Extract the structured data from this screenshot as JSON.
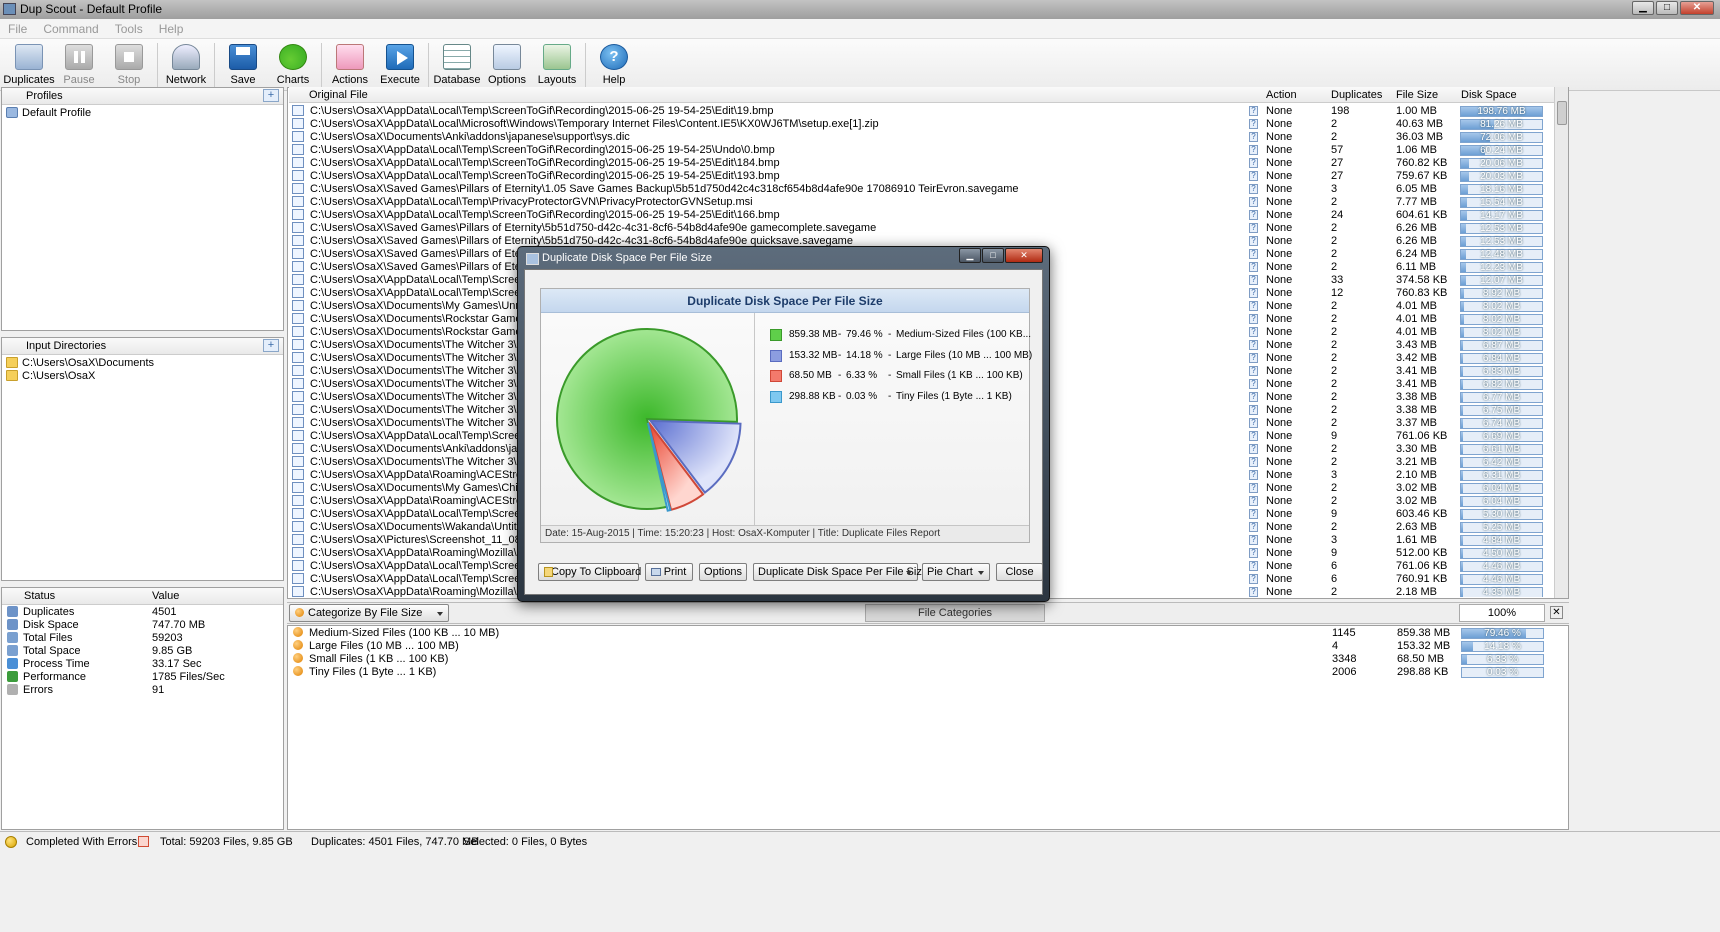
{
  "window": {
    "title": "Dup Scout - Default Profile"
  },
  "menu": [
    "File",
    "Command",
    "Tools",
    "Help"
  ],
  "toolbar": [
    {
      "label": "Duplicates",
      "icon": "duplicates-icon",
      "cls": "dup"
    },
    {
      "label": "Pause",
      "icon": "pause-icon",
      "cls": "pause",
      "disabled": true
    },
    {
      "label": "Stop",
      "icon": "stop-icon",
      "cls": "stop",
      "disabled": true
    },
    {
      "sep": true
    },
    {
      "label": "Network",
      "icon": "network-icon",
      "cls": "net"
    },
    {
      "sep": true
    },
    {
      "label": "Save",
      "icon": "save-icon",
      "cls": "save"
    },
    {
      "label": "Charts",
      "icon": "charts-icon",
      "cls": "charts"
    },
    {
      "sep": true
    },
    {
      "label": "Actions",
      "icon": "actions-icon",
      "cls": "actions"
    },
    {
      "label": "Execute",
      "icon": "execute-icon",
      "cls": "exec"
    },
    {
      "sep": true
    },
    {
      "label": "Database",
      "icon": "database-icon",
      "cls": "db"
    },
    {
      "label": "Options",
      "icon": "options-icon",
      "cls": "opt"
    },
    {
      "label": "Layouts",
      "icon": "layouts-icon",
      "cls": "lay"
    },
    {
      "sep": true
    },
    {
      "label": "Help",
      "icon": "help-icon",
      "cls": "help"
    }
  ],
  "profiles": {
    "header": "Profiles",
    "items": [
      "Default Profile"
    ]
  },
  "input_dirs": {
    "header": "Input Directories",
    "items": [
      "C:\\Users\\OsaX\\Documents",
      "C:\\Users\\OsaX"
    ]
  },
  "status_panel": {
    "col_status": "Status",
    "col_value": "Value",
    "rows": [
      {
        "label": "Duplicates",
        "value": "4501",
        "color": "#6d93c8"
      },
      {
        "label": "Disk Space",
        "value": "747.70 MB",
        "color": "#6d93c8"
      },
      {
        "label": "Total Files",
        "value": "59203",
        "color": "#7aa0d0"
      },
      {
        "label": "Total Space",
        "value": "9.85 GB",
        "color": "#7aa0d0"
      },
      {
        "label": "Process Time",
        "value": "33.17 Sec",
        "color": "#4a8fd6"
      },
      {
        "label": "Performance",
        "value": "1785 Files/Sec",
        "color": "#3c9c3c"
      },
      {
        "label": "Errors",
        "value": "91",
        "color": "#b0b0b0"
      }
    ]
  },
  "file_list": {
    "headers": {
      "file": "Original File",
      "action": "Action",
      "dups": "Duplicates",
      "size": "File Size",
      "space": "Disk Space"
    },
    "rows": [
      {
        "path": "C:\\Users\\OsaX\\AppData\\Local\\Temp\\ScreenToGif\\Recording\\2015-06-25 19-54-25\\Edit\\19.bmp",
        "action": "None",
        "dups": "198",
        "size": "1.00 MB",
        "space": "198.76 MB",
        "pct": 100
      },
      {
        "path": "C:\\Users\\OsaX\\AppData\\Local\\Microsoft\\Windows\\Temporary Internet Files\\Content.IE5\\KX0WJ6TM\\setup.exe[1].zip",
        "action": "None",
        "dups": "2",
        "size": "40.63 MB",
        "space": "81.26 MB",
        "pct": 41
      },
      {
        "path": "C:\\Users\\OsaX\\Documents\\Anki\\addons\\japanese\\support\\sys.dic",
        "action": "None",
        "dups": "2",
        "size": "36.03 MB",
        "space": "72.06 MB",
        "pct": 36
      },
      {
        "path": "C:\\Users\\OsaX\\AppData\\Local\\Temp\\ScreenToGif\\Recording\\2015-06-25 19-54-25\\Undo\\0.bmp",
        "action": "None",
        "dups": "57",
        "size": "1.06 MB",
        "space": "60.24 MB",
        "pct": 30
      },
      {
        "path": "C:\\Users\\OsaX\\AppData\\Local\\Temp\\ScreenToGif\\Recording\\2015-06-25 19-54-25\\Edit\\184.bmp",
        "action": "None",
        "dups": "27",
        "size": "760.82 KB",
        "space": "20.06 MB",
        "pct": 10
      },
      {
        "path": "C:\\Users\\OsaX\\AppData\\Local\\Temp\\ScreenToGif\\Recording\\2015-06-25 19-54-25\\Edit\\193.bmp",
        "action": "None",
        "dups": "27",
        "size": "759.67 KB",
        "space": "20.03 MB",
        "pct": 10
      },
      {
        "path": "C:\\Users\\OsaX\\Saved Games\\Pillars of Eternity\\1.05 Save Games Backup\\5b51d750d42c4c318cf654b8d4afe90e 17086910 TeirEvron.savegame",
        "action": "None",
        "dups": "3",
        "size": "6.05 MB",
        "space": "18.16 MB",
        "pct": 9
      },
      {
        "path": "C:\\Users\\OsaX\\AppData\\Local\\Temp\\PrivacyProtectorGVN\\PrivacyProtectorGVNSetup.msi",
        "action": "None",
        "dups": "2",
        "size": "7.77 MB",
        "space": "15.54 MB",
        "pct": 8
      },
      {
        "path": "C:\\Users\\OsaX\\AppData\\Local\\Temp\\ScreenToGif\\Recording\\2015-06-25 19-54-25\\Edit\\166.bmp",
        "action": "None",
        "dups": "24",
        "size": "604.61 KB",
        "space": "14.17 MB",
        "pct": 7
      },
      {
        "path": "C:\\Users\\OsaX\\Saved Games\\Pillars of Eternity\\5b51d750-d42c-4c31-8cf6-54b8d4afe90e gamecomplete.savegame",
        "action": "None",
        "dups": "2",
        "size": "6.26 MB",
        "space": "12.53 MB",
        "pct": 6
      },
      {
        "path": "C:\\Users\\OsaX\\Saved Games\\Pillars of Eternity\\5b51d750-d42c-4c31-8cf6-54b8d4afe90e quicksave.savegame",
        "action": "None",
        "dups": "2",
        "size": "6.26 MB",
        "space": "12.53 MB",
        "pct": 6
      },
      {
        "path": "C:\\Users\\OsaX\\Saved Games\\Pillars of Eternity\\5",
        "action": "None",
        "dups": "2",
        "size": "6.24 MB",
        "space": "12.48 MB",
        "pct": 6
      },
      {
        "path": "C:\\Users\\OsaX\\Saved Games\\Pillars of Eternity\\5",
        "action": "None",
        "dups": "2",
        "size": "6.11 MB",
        "space": "12.23 MB",
        "pct": 6
      },
      {
        "path": "C:\\Users\\OsaX\\AppData\\Local\\Temp\\ScreenToG",
        "action": "None",
        "dups": "33",
        "size": "374.58 KB",
        "space": "12.07 MB",
        "pct": 6
      },
      {
        "path": "C:\\Users\\OsaX\\AppData\\Local\\Temp\\ScreenToG",
        "action": "None",
        "dups": "12",
        "size": "760.83 KB",
        "space": "8.92 MB",
        "pct": 4
      },
      {
        "path": "C:\\Users\\OsaX\\Documents\\My Games\\UnrealEn",
        "action": "None",
        "dups": "2",
        "size": "4.01 MB",
        "space": "8.02 MB",
        "pct": 4
      },
      {
        "path": "C:\\Users\\OsaX\\Documents\\Rockstar Games\\Soc",
        "action": "None",
        "dups": "2",
        "size": "4.01 MB",
        "space": "8.02 MB",
        "pct": 4
      },
      {
        "path": "C:\\Users\\OsaX\\Documents\\Rockstar Games\\Soc",
        "action": "None",
        "dups": "2",
        "size": "4.01 MB",
        "space": "8.02 MB",
        "pct": 4
      },
      {
        "path": "C:\\Users\\OsaX\\Documents\\The Witcher 3\\game",
        "action": "None",
        "dups": "2",
        "size": "3.43 MB",
        "space": "6.87 MB",
        "pct": 3
      },
      {
        "path": "C:\\Users\\OsaX\\Documents\\The Witcher 3\\game",
        "action": "None",
        "dups": "2",
        "size": "3.42 MB",
        "space": "6.84 MB",
        "pct": 3
      },
      {
        "path": "C:\\Users\\OsaX\\Documents\\The Witcher 3\\game",
        "action": "None",
        "dups": "2",
        "size": "3.41 MB",
        "space": "6.83 MB",
        "pct": 3
      },
      {
        "path": "C:\\Users\\OsaX\\Documents\\The Witcher 3\\game",
        "action": "None",
        "dups": "2",
        "size": "3.41 MB",
        "space": "6.82 MB",
        "pct": 3
      },
      {
        "path": "C:\\Users\\OsaX\\Documents\\The Witcher 3\\game",
        "action": "None",
        "dups": "2",
        "size": "3.38 MB",
        "space": "6.77 MB",
        "pct": 3
      },
      {
        "path": "C:\\Users\\OsaX\\Documents\\The Witcher 3\\game",
        "action": "None",
        "dups": "2",
        "size": "3.38 MB",
        "space": "6.75 MB",
        "pct": 3
      },
      {
        "path": "C:\\Users\\OsaX\\Documents\\The Witcher 3\\game",
        "action": "None",
        "dups": "2",
        "size": "3.37 MB",
        "space": "6.74 MB",
        "pct": 3
      },
      {
        "path": "C:\\Users\\OsaX\\AppData\\Local\\Temp\\ScreenToG",
        "action": "None",
        "dups": "9",
        "size": "761.06 KB",
        "space": "6.69 MB",
        "pct": 3
      },
      {
        "path": "C:\\Users\\OsaX\\Documents\\Anki\\addons\\japane",
        "action": "None",
        "dups": "2",
        "size": "3.30 MB",
        "space": "6.61 MB",
        "pct": 3
      },
      {
        "path": "C:\\Users\\OsaX\\Documents\\The Witcher 3\\game",
        "action": "None",
        "dups": "2",
        "size": "3.21 MB",
        "space": "6.42 MB",
        "pct": 3
      },
      {
        "path": "C:\\Users\\OsaX\\AppData\\Roaming\\ACEStream\\u",
        "action": "None",
        "dups": "3",
        "size": "2.10 MB",
        "space": "6.31 MB",
        "pct": 3
      },
      {
        "path": "C:\\Users\\OsaX\\Documents\\My Games\\Chivalry",
        "action": "None",
        "dups": "2",
        "size": "3.02 MB",
        "space": "6.04 MB",
        "pct": 3
      },
      {
        "path": "C:\\Users\\OsaX\\AppData\\Roaming\\ACEStream\\u",
        "action": "None",
        "dups": "2",
        "size": "3.02 MB",
        "space": "6.04 MB",
        "pct": 3
      },
      {
        "path": "C:\\Users\\OsaX\\AppData\\Local\\Temp\\ScreenToG",
        "action": "None",
        "dups": "9",
        "size": "603.46 KB",
        "space": "5.30 MB",
        "pct": 3
      },
      {
        "path": "C:\\Users\\OsaX\\Documents\\Wakanda\\Untitled\\U",
        "action": "None",
        "dups": "2",
        "size": "2.63 MB",
        "space": "5.25 MB",
        "pct": 3
      },
      {
        "path": "C:\\Users\\OsaX\\Pictures\\Screenshot_11_08_2015_",
        "action": "None",
        "dups": "3",
        "size": "1.61 MB",
        "space": "4.84 MB",
        "pct": 2
      },
      {
        "path": "C:\\Users\\OsaX\\AppData\\Roaming\\Mozilla\\Firefo",
        "action": "None",
        "dups": "9",
        "size": "512.00 KB",
        "space": "4.50 MB",
        "pct": 2
      },
      {
        "path": "C:\\Users\\OsaX\\AppData\\Local\\Temp\\ScreenToG",
        "action": "None",
        "dups": "6",
        "size": "761.06 KB",
        "space": "4.46 MB",
        "pct": 2
      },
      {
        "path": "C:\\Users\\OsaX\\AppData\\Local\\Temp\\ScreenToG",
        "action": "None",
        "dups": "6",
        "size": "760.91 KB",
        "space": "4.46 MB",
        "pct": 2
      },
      {
        "path": "C:\\Users\\OsaX\\AppData\\Roaming\\Mozilla\\Firefo",
        "action": "None",
        "dups": "2",
        "size": "2.18 MB",
        "space": "4.35 MB",
        "pct": 2
      }
    ]
  },
  "midbar": {
    "categorize": "Categorize By File Size",
    "tab": "File Categories",
    "percent": "100%"
  },
  "categories": [
    {
      "label": "Medium-Sized Files (100 KB ... 10 MB)",
      "count": "1145",
      "size": "859.38 MB",
      "pct_label": "79.46 %",
      "pct": 79.46
    },
    {
      "label": "Large Files (10 MB ... 100 MB)",
      "count": "4",
      "size": "153.32 MB",
      "pct_label": "14.18 %",
      "pct": 14.18
    },
    {
      "label": "Small Files (1 KB ... 100 KB)",
      "count": "3348",
      "size": "68.50 MB",
      "pct_label": "6.33 %",
      "pct": 6.33
    },
    {
      "label": "Tiny Files (1 Byte ... 1 KB)",
      "count": "2006",
      "size": "298.88 KB",
      "pct_label": "0.03 %",
      "pct": 0.03
    }
  ],
  "statusbar": {
    "left": "Completed With Errors",
    "total": "Total: 59203 Files, 9.85 GB",
    "dups": "Duplicates: 4501 Files, 747.70 MB",
    "selected": "Selected: 0 Files, 0 Bytes"
  },
  "dialog": {
    "title": "Duplicate Disk Space Per File Size",
    "footer": "Date: 15-Aug-2015 | Time: 15:20:23 | Host: OsaX-Komputer | Title: Duplicate Files Report",
    "buttons": {
      "copy": "Copy To Clipboard",
      "print": "Print",
      "options": "Options",
      "report": "Duplicate Disk Space Per File Size",
      "type": "Pie Chart",
      "close": "Close"
    }
  },
  "chart_data": {
    "type": "pie",
    "title": "Duplicate Disk Space Per File Size",
    "legend_position": "right",
    "slices": [
      {
        "value_label": "859.38 MB",
        "pct_label": "79.46 %",
        "name": "Medium-Sized Files (100 KB...",
        "value": 79.46,
        "color": "#5fcf4a",
        "stroke": "#3a9a2a"
      },
      {
        "value_label": "153.32 MB",
        "pct_label": "14.18 %",
        "name": "Large Files (10 MB ... 100 MB)",
        "value": 14.18,
        "color": "#8c9de0",
        "stroke": "#5a6cc0"
      },
      {
        "value_label": "68.50 MB",
        "pct_label": "6.33 %",
        "name": "Small Files (1 KB ... 100 KB)",
        "value": 6.33,
        "color": "#f37a6c",
        "stroke": "#d04838"
      },
      {
        "value_label": "298.88 KB",
        "pct_label": "0.03 %",
        "name": "Tiny Files (1 Byte ... 1 KB)",
        "value": 0.03,
        "color": "#7ec8f0",
        "stroke": "#3a98cc"
      }
    ]
  }
}
